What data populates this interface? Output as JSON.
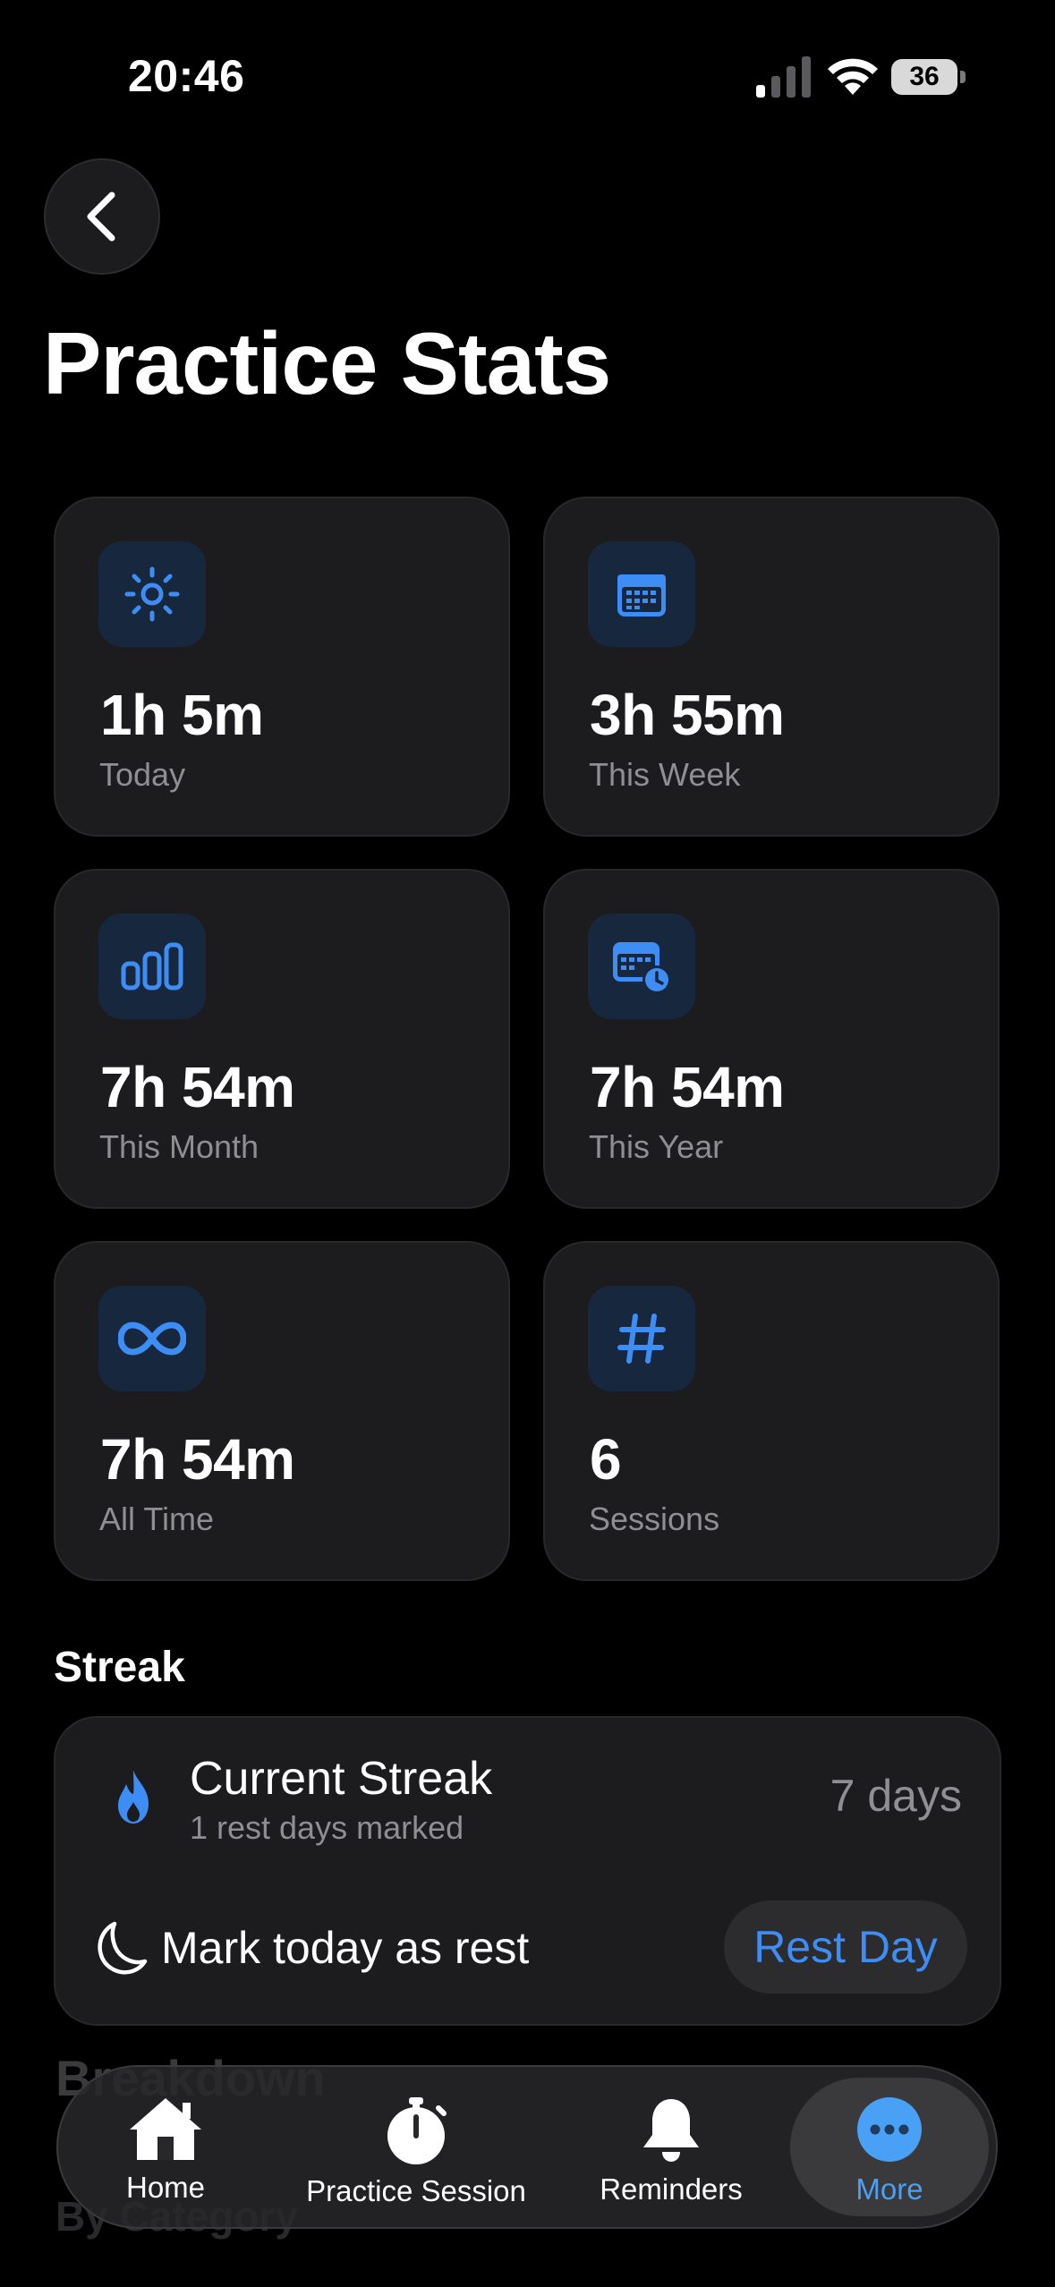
{
  "status_bar": {
    "time": "20:46",
    "battery": "36"
  },
  "header": {
    "title": "Practice Stats"
  },
  "stats": [
    {
      "value": "1h 5m",
      "label": "Today",
      "icon": "sun-icon"
    },
    {
      "value": "3h 55m",
      "label": "This Week",
      "icon": "calendar-icon"
    },
    {
      "value": "7h 54m",
      "label": "This Month",
      "icon": "bar-chart-icon"
    },
    {
      "value": "7h 54m",
      "label": "This Year",
      "icon": "calendar-clock-icon"
    },
    {
      "value": "7h 54m",
      "label": "All Time",
      "icon": "infinity-icon"
    },
    {
      "value": "6",
      "label": "Sessions",
      "icon": "hash-icon"
    }
  ],
  "streak": {
    "section_title": "Streak",
    "title": "Current Streak",
    "subtitle": "1 rest days marked",
    "days": "7 days",
    "rest_prompt": "Mark today as rest",
    "rest_button": "Rest Day"
  },
  "behind_content": {
    "title": "Breakdown",
    "subtitle": "By Category"
  },
  "tab_bar": {
    "tabs": [
      {
        "label": "Home",
        "icon": "home-icon"
      },
      {
        "label": "Practice Session",
        "icon": "stopwatch-icon"
      },
      {
        "label": "Reminders",
        "icon": "bell-icon"
      },
      {
        "label": "More",
        "icon": "more-icon"
      }
    ],
    "active": "More"
  },
  "colors": {
    "accent": "#3d8df5",
    "card": "#1c1c1e",
    "icon_bg": "#17273d",
    "secondary_text": "#8e8e93"
  }
}
